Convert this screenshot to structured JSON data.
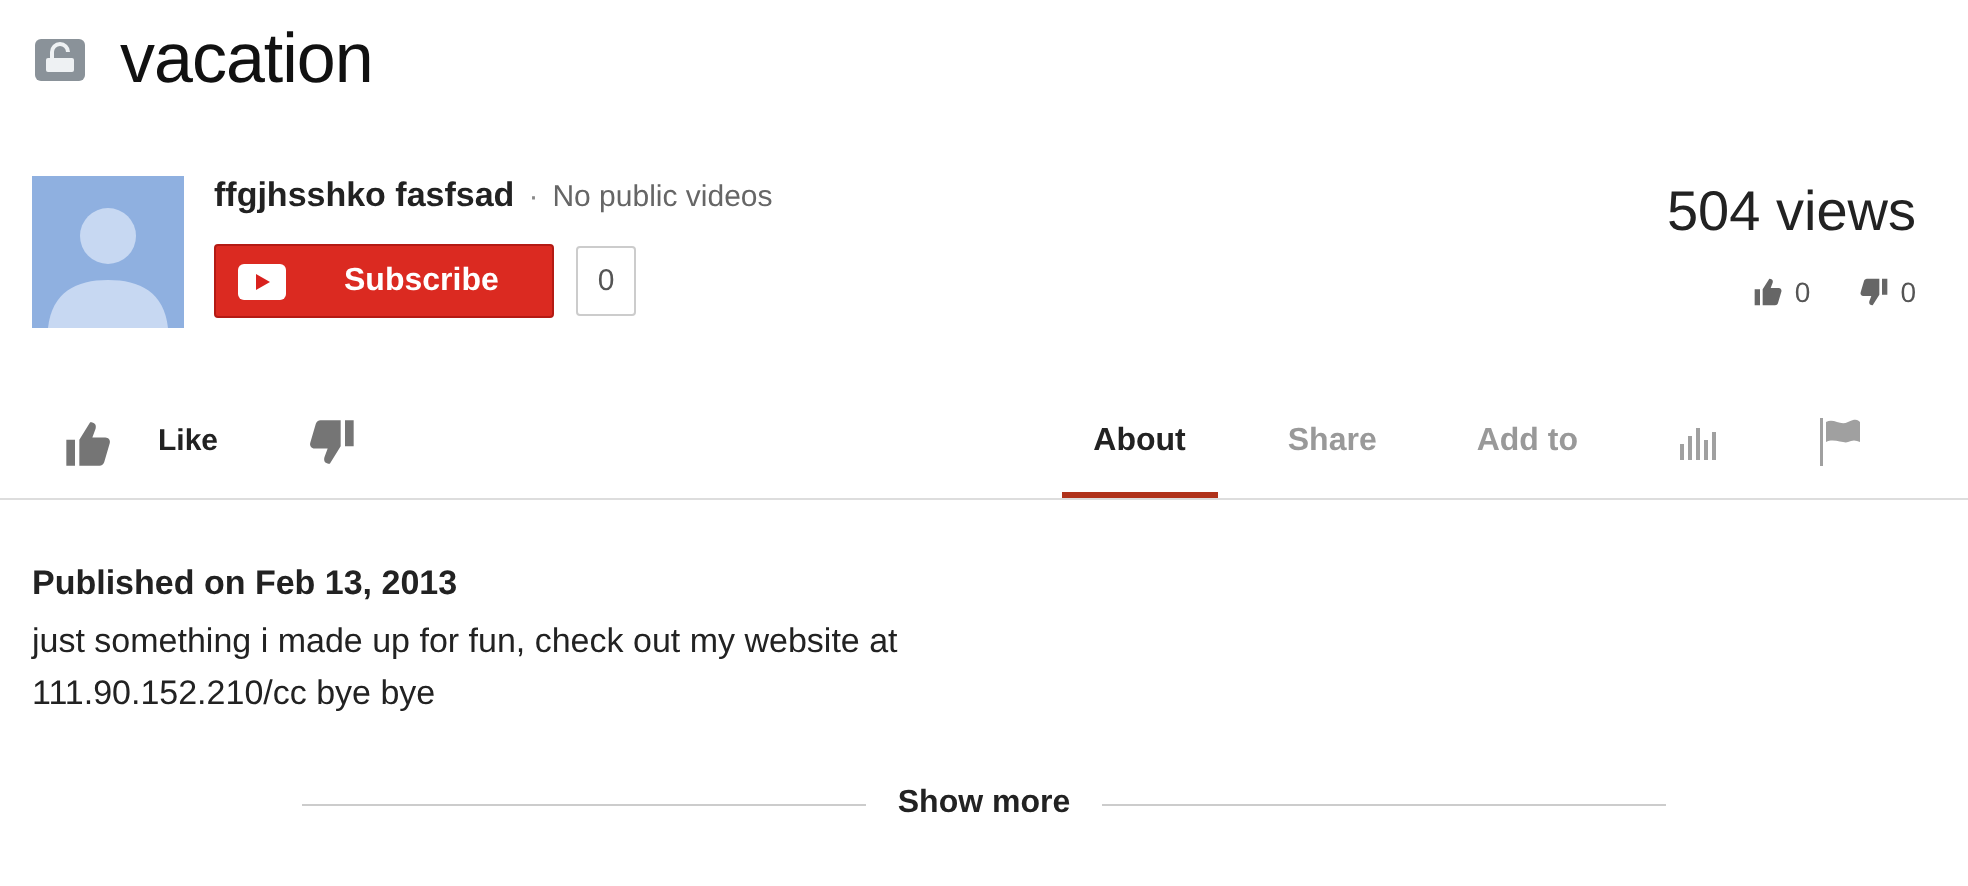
{
  "video": {
    "title": "vacation",
    "views": "504 views",
    "like_count": "0",
    "dislike_count": "0"
  },
  "channel": {
    "name": "ffgjhsshko fasfsad",
    "separator": "·",
    "videos_note": "No public videos",
    "subscribe_label": "Subscribe",
    "subscriber_count": "0"
  },
  "actions": {
    "like_label": "Like"
  },
  "tabs": [
    {
      "kind": "text",
      "label": "About",
      "selected": true
    },
    {
      "kind": "text",
      "label": "Share",
      "selected": false
    },
    {
      "kind": "text",
      "label": "Add to",
      "selected": false
    },
    {
      "kind": "stats",
      "selected": false
    },
    {
      "kind": "flag",
      "selected": false
    }
  ],
  "description": {
    "published": "Published on Feb 13, 2013",
    "text": "just something i made up for fun, check out my website at 111.90.152.210/cc bye bye",
    "show_more": "Show more"
  }
}
